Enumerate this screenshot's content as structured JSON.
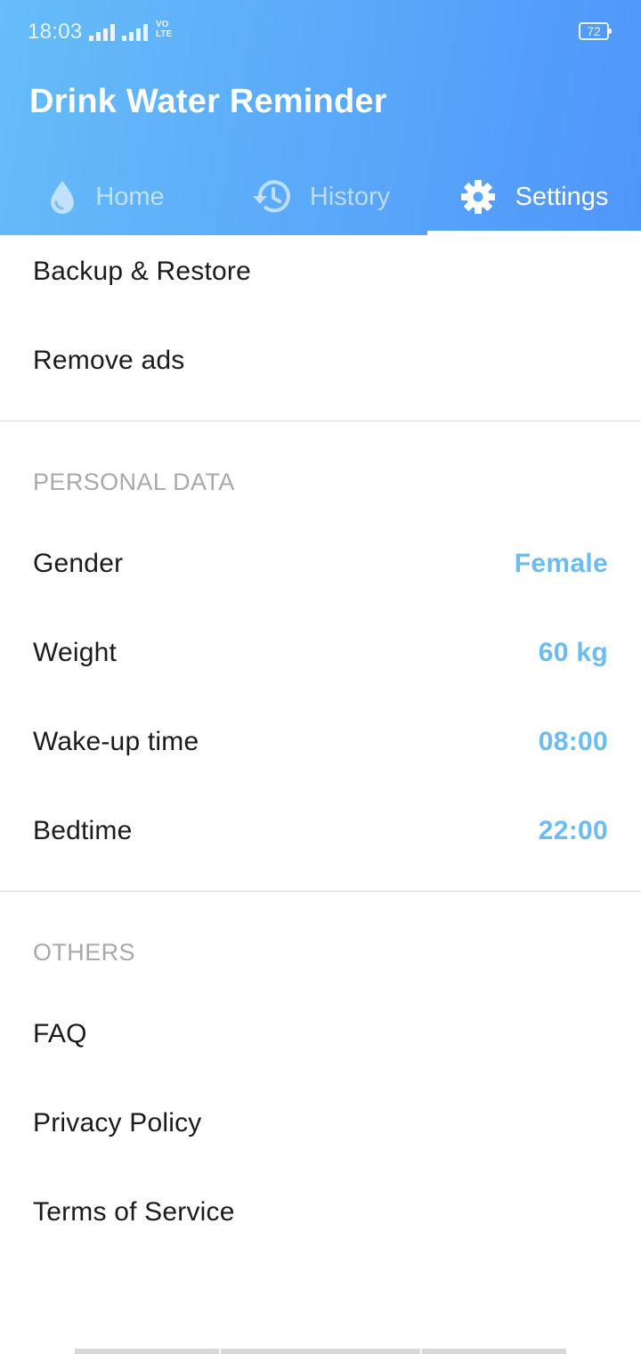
{
  "status_bar": {
    "time": "18:03",
    "volte_line1": "VO",
    "volte_line2": "LTE",
    "battery": "72"
  },
  "app": {
    "title": "Drink Water Reminder"
  },
  "tabs": [
    {
      "label": "Home",
      "icon": "water-drop-icon",
      "active": false
    },
    {
      "label": "History",
      "icon": "history-icon",
      "active": false
    },
    {
      "label": "Settings",
      "icon": "gear-icon",
      "active": true
    }
  ],
  "general": {
    "backup_label": "Backup & Restore",
    "remove_ads_label": "Remove ads"
  },
  "personal_data": {
    "header": "PERSONAL DATA",
    "gender_label": "Gender",
    "gender_value": "Female",
    "weight_label": "Weight",
    "weight_value": "60 kg",
    "wakeup_label": "Wake-up time",
    "wakeup_value": "08:00",
    "bedtime_label": "Bedtime",
    "bedtime_value": "22:00"
  },
  "others": {
    "header": "OTHERS",
    "faq_label": "FAQ",
    "privacy_label": "Privacy Policy",
    "terms_label": "Terms of Service"
  },
  "colors": {
    "header_start": "#66bdf8",
    "header_end": "#4f96fb",
    "value_accent": "#6bbcf2"
  }
}
